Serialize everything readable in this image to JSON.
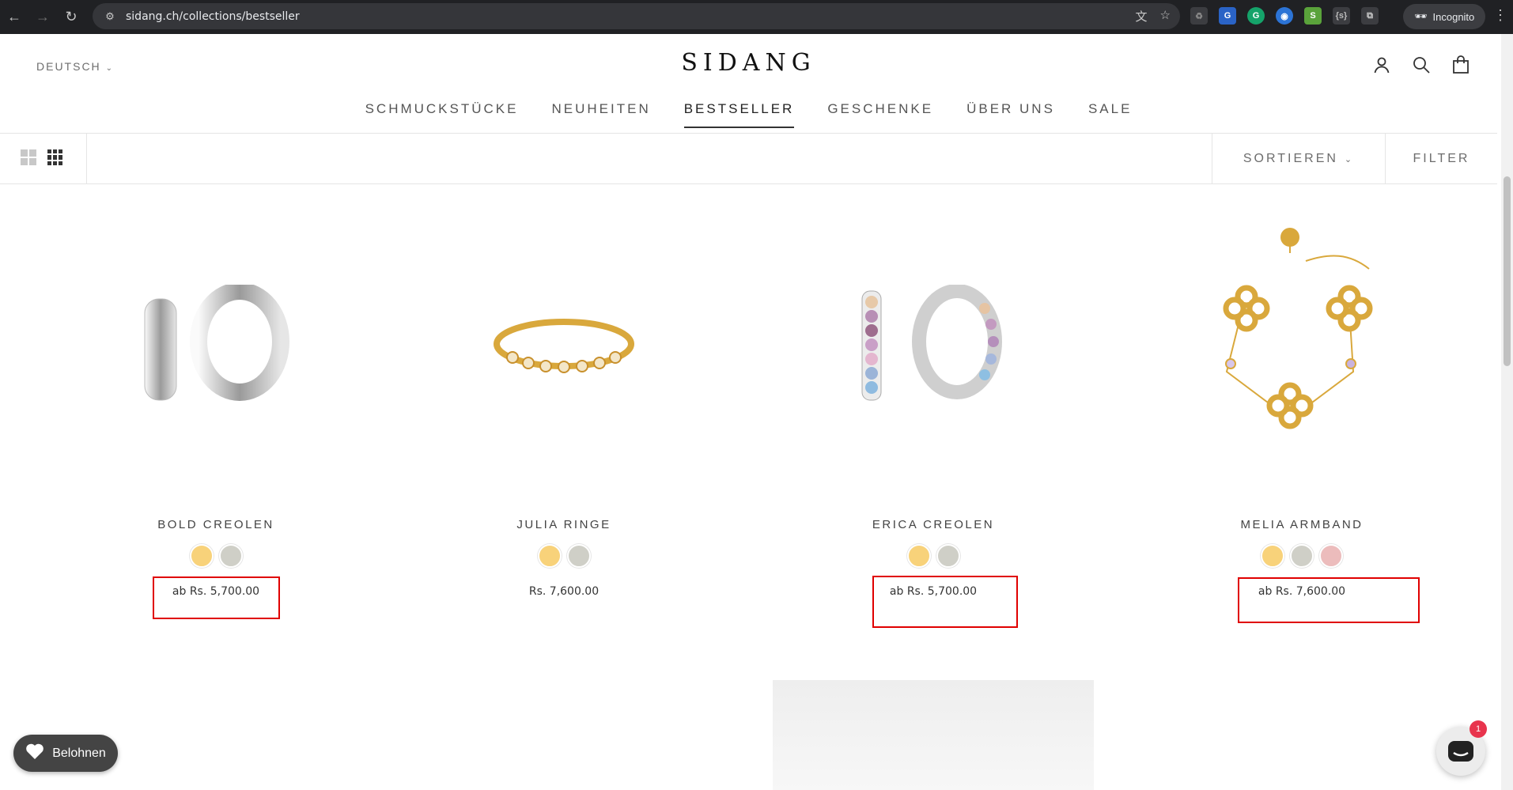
{
  "browser": {
    "url": "sidang.ch/collections/bestseller",
    "incognito_label": "Incognito"
  },
  "header": {
    "language": "DEUTSCH",
    "logo": "SIDANG",
    "nav": [
      "SCHMUCKSTÜCKE",
      "NEUHEITEN",
      "BESTSELLER",
      "GESCHENKE",
      "ÜBER UNS",
      "SALE"
    ],
    "active_nav": "BESTSELLER"
  },
  "toolbar": {
    "sort_label": "SORTIEREN",
    "filter_label": "FILTER"
  },
  "products": [
    {
      "name": "BOLD CREOLEN",
      "price": "ab Rs. 5,700.00",
      "swatches": [
        "#f8d27a",
        "#cfcfc7"
      ],
      "highlighted": true
    },
    {
      "name": "JULIA RINGE",
      "price": "Rs. 7,600.00",
      "swatches": [
        "#f8d27a",
        "#cfcfc7"
      ],
      "highlighted": false
    },
    {
      "name": "ERICA CREOLEN",
      "price": "ab Rs. 5,700.00",
      "swatches": [
        "#f8d27a",
        "#cfcfc7"
      ],
      "highlighted": true
    },
    {
      "name": "MELIA ARMBAND",
      "price": "ab Rs. 7,600.00",
      "swatches": [
        "#f8d27a",
        "#cfcfc7",
        "#ecbcbc"
      ],
      "highlighted": true
    }
  ],
  "widgets": {
    "reward_label": "Belohnen",
    "chat_badge": "1"
  },
  "colors": {
    "highlight": "#e00000",
    "gold": "#d9a83c",
    "silver": "#c8c8c8"
  }
}
